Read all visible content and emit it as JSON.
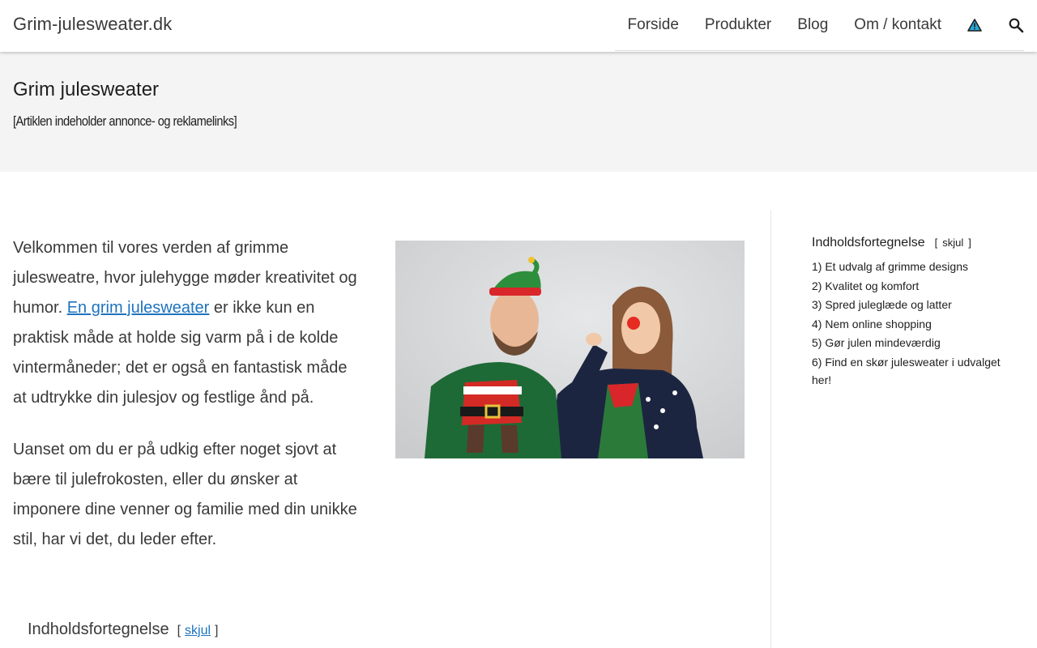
{
  "header": {
    "site_title": "Grim-julesweater.dk",
    "nav": [
      {
        "label": "Forside"
      },
      {
        "label": "Produkter"
      },
      {
        "label": "Blog"
      },
      {
        "label": "Om / kontakt"
      }
    ],
    "icons": [
      "warning-triangle-icon",
      "search-icon"
    ]
  },
  "title_band": {
    "title": "Grim julesweater",
    "disclaimer": "[Artiklen indeholder annonce- og reklamelinks]"
  },
  "main": {
    "p1_before": "Velkommen til vores verden af grimme julesweatre, hvor julehygge møder kreativitet og humor. ",
    "p1_link": "En grim julesweater",
    "p1_after": " er ikke kun en praktisk måde at holde sig varm på i de kolde vintermåneder; det er også en fantastisk måde at udtrykke din julesjov og festlige ånd på.",
    "p2": "Uanset om du er på udkig efter noget sjovt at bære til julefrokosten, eller du ønsker at imponere dine venner og familie med din unikke stil, har vi det, du leder efter."
  },
  "toc": {
    "heading": "Indholdsfortegnelse",
    "toggle": "skjul",
    "open_bracket": "[",
    "close_bracket": "]",
    "items": [
      "1) Et udvalg af grimme designs",
      "2) Kvalitet og komfort",
      "3) Spred juleglæde og latter",
      "4) Nem online shopping",
      "5) Gør julen mindeværdig",
      "6) Find en skør julesweater i udvalget her!"
    ]
  },
  "colors": {
    "link": "#1e73be",
    "band_bg": "#f4f4f4",
    "text": "#3a3a3a"
  }
}
